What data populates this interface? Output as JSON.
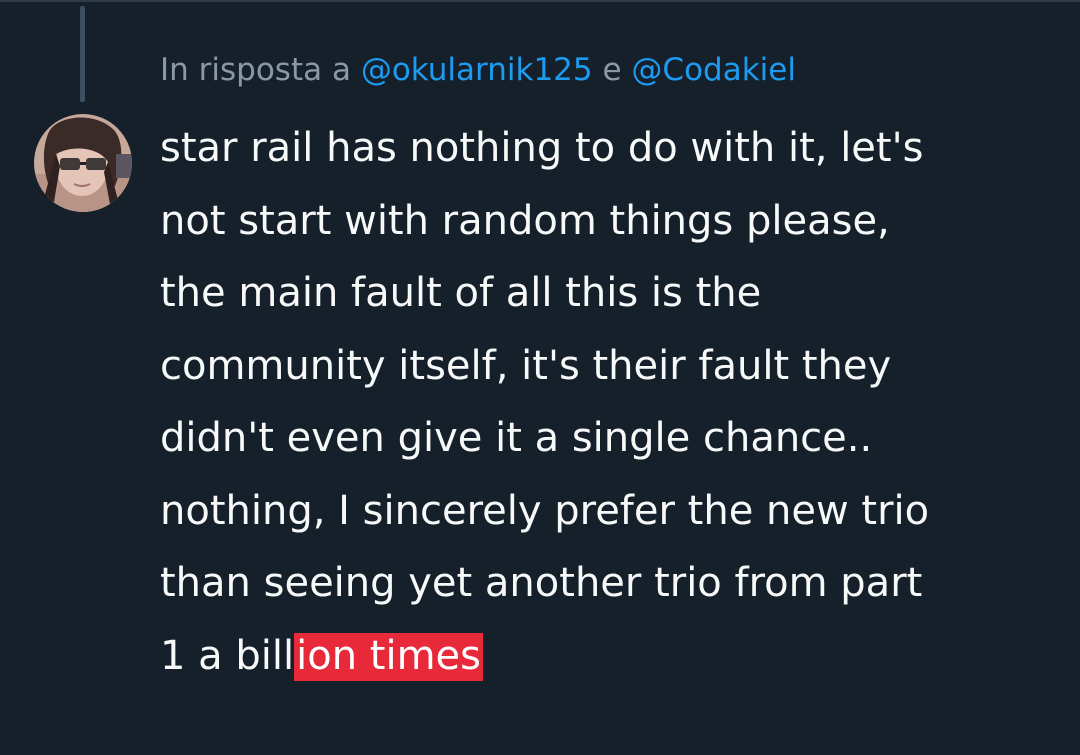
{
  "reply": {
    "prefix": "In risposta a",
    "mention_1": "@okularnik125",
    "conjunction": "e",
    "mention_2": "@Codakiel"
  },
  "tweet": {
    "lines": [
      "star rail has nothing to do with it, let's",
      "not start with random things please,",
      "the main fault of all this is the",
      "community itself, it's their fault they",
      "didn't even give it a single chance..",
      "nothing, I sincerely prefer the new trio",
      "than seeing yet another trio from part"
    ],
    "last_line_plain": "1 a bill",
    "last_line_highlighted": "ion times"
  },
  "colors": {
    "background": "#15202b",
    "text": "#f7f9f9",
    "muted": "#8b98a5",
    "mention": "#1d9bf0",
    "highlight": "#e8293a"
  },
  "icons": {
    "avatar": "user-avatar-image"
  }
}
